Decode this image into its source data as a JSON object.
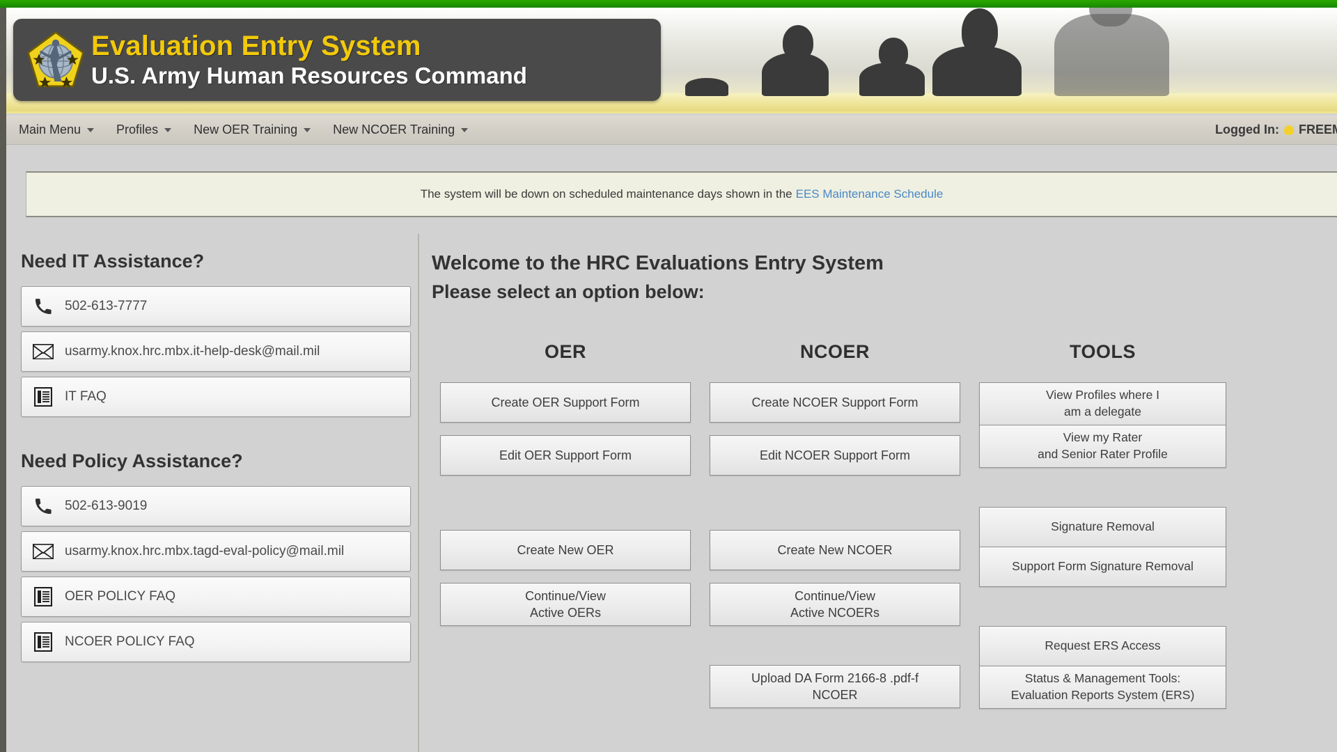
{
  "header": {
    "title_line1": "Evaluation Entry System",
    "title_line2": "U.S. Army Human Resources Command",
    "logo_name": "hrc-pentagon-logo"
  },
  "nav": {
    "items": [
      {
        "label": "Main Menu"
      },
      {
        "label": "Profiles"
      },
      {
        "label": "New OER Training"
      },
      {
        "label": "New NCOER Training"
      }
    ],
    "logged_in_label": "Logged In:",
    "logged_in_user": "FREEM"
  },
  "maintenance": {
    "text": "The system will be down on scheduled maintenance days shown in the",
    "link_text": "EES Maintenance Schedule",
    "link_color": "#4a88c7"
  },
  "sidebar": {
    "it_heading": "Need IT Assistance?",
    "it_items": [
      {
        "icon": "phone-icon",
        "label": "502-613-7777"
      },
      {
        "icon": "envelope-icon",
        "label": "usarmy.knox.hrc.mbx.it-help-desk@mail.mil"
      },
      {
        "icon": "document-icon",
        "label": "IT FAQ"
      }
    ],
    "policy_heading": "Need Policy Assistance?",
    "policy_items": [
      {
        "icon": "phone-icon",
        "label": "502-613-9019"
      },
      {
        "icon": "envelope-icon",
        "label": "usarmy.knox.hrc.mbx.tagd-eval-policy@mail.mil"
      },
      {
        "icon": "document-icon",
        "label": "OER POLICY FAQ"
      },
      {
        "icon": "document-icon",
        "label": "NCOER POLICY FAQ"
      }
    ]
  },
  "main": {
    "welcome_line1": "Welcome to the HRC Evaluations Entry System",
    "welcome_line2": "Please select an option below:",
    "columns": {
      "oer": {
        "heading": "OER",
        "buttons": [
          "Create OER Support Form",
          "Edit OER Support Form",
          "Create New OER",
          "Continue/View\nActive OERs"
        ]
      },
      "ncoer": {
        "heading": "NCOER",
        "buttons": [
          "Create NCOER Support Form",
          "Edit NCOER Support Form",
          "Create New NCOER",
          "Continue/View\nActive NCOERs",
          "Upload DA Form 2166-8 .pdf-f\nNCOER"
        ]
      },
      "tools": {
        "heading": "TOOLS",
        "buttons": [
          "View Profiles where I\nam a delegate",
          "View my Rater\nand Senior Rater Profile",
          "Signature Removal",
          "Support Form Signature Removal",
          "Request ERS Access",
          "Status & Management Tools:\nEvaluation Reports System (ERS)"
        ]
      }
    }
  },
  "colors": {
    "top_bar_green": "#1f9c00",
    "title_gold": "#f2c90b",
    "page_bg": "#d2d2d2",
    "notice_bg": "#eff0e1"
  }
}
